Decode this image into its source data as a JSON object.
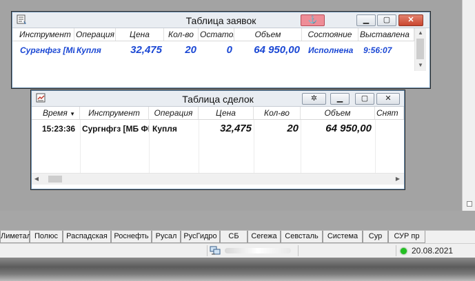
{
  "orders_window": {
    "title": "Таблица заявок",
    "columns": [
      "Инструмент",
      "Операция",
      "Цена",
      "Кол-во",
      "Остаток",
      "Объем",
      "Состояние",
      "Выставлена"
    ],
    "row": {
      "instrument": "Сургнфгз [МБ ФР: Т+ Акции]",
      "operation": "Купля",
      "price": "32,475",
      "qty": "20",
      "remainder": "0",
      "volume": "64 950,00",
      "state": "Исполнена",
      "time": "9:56:07"
    }
  },
  "trades_window": {
    "title": "Таблица сделок",
    "columns": [
      "Время",
      "Инструмент",
      "Операция",
      "Цена",
      "Кол-во",
      "Объем",
      "Снят"
    ],
    "sort_indicator": "▼",
    "row": {
      "time": "15:23:36",
      "instrument": "Сургнфгз [МБ ФР: Т+ Акции]",
      "operation": "Купля",
      "price": "32,475",
      "qty": "20",
      "volume": "64 950,00",
      "removed": ""
    }
  },
  "tabs": [
    "Лиметал",
    "Полюс",
    "Распадская",
    "Роснефть",
    "Русал",
    "РусГидро",
    "СБ",
    "Сегежа",
    "Севсталь",
    "Система",
    "Сур",
    "СУР пр"
  ],
  "status": {
    "date": "20.08.2021"
  },
  "colors": {
    "data_blue": "#1a47d4",
    "pin_red": "#ee8d97",
    "close_red": "#c9462f",
    "status_led": "#22c022"
  }
}
